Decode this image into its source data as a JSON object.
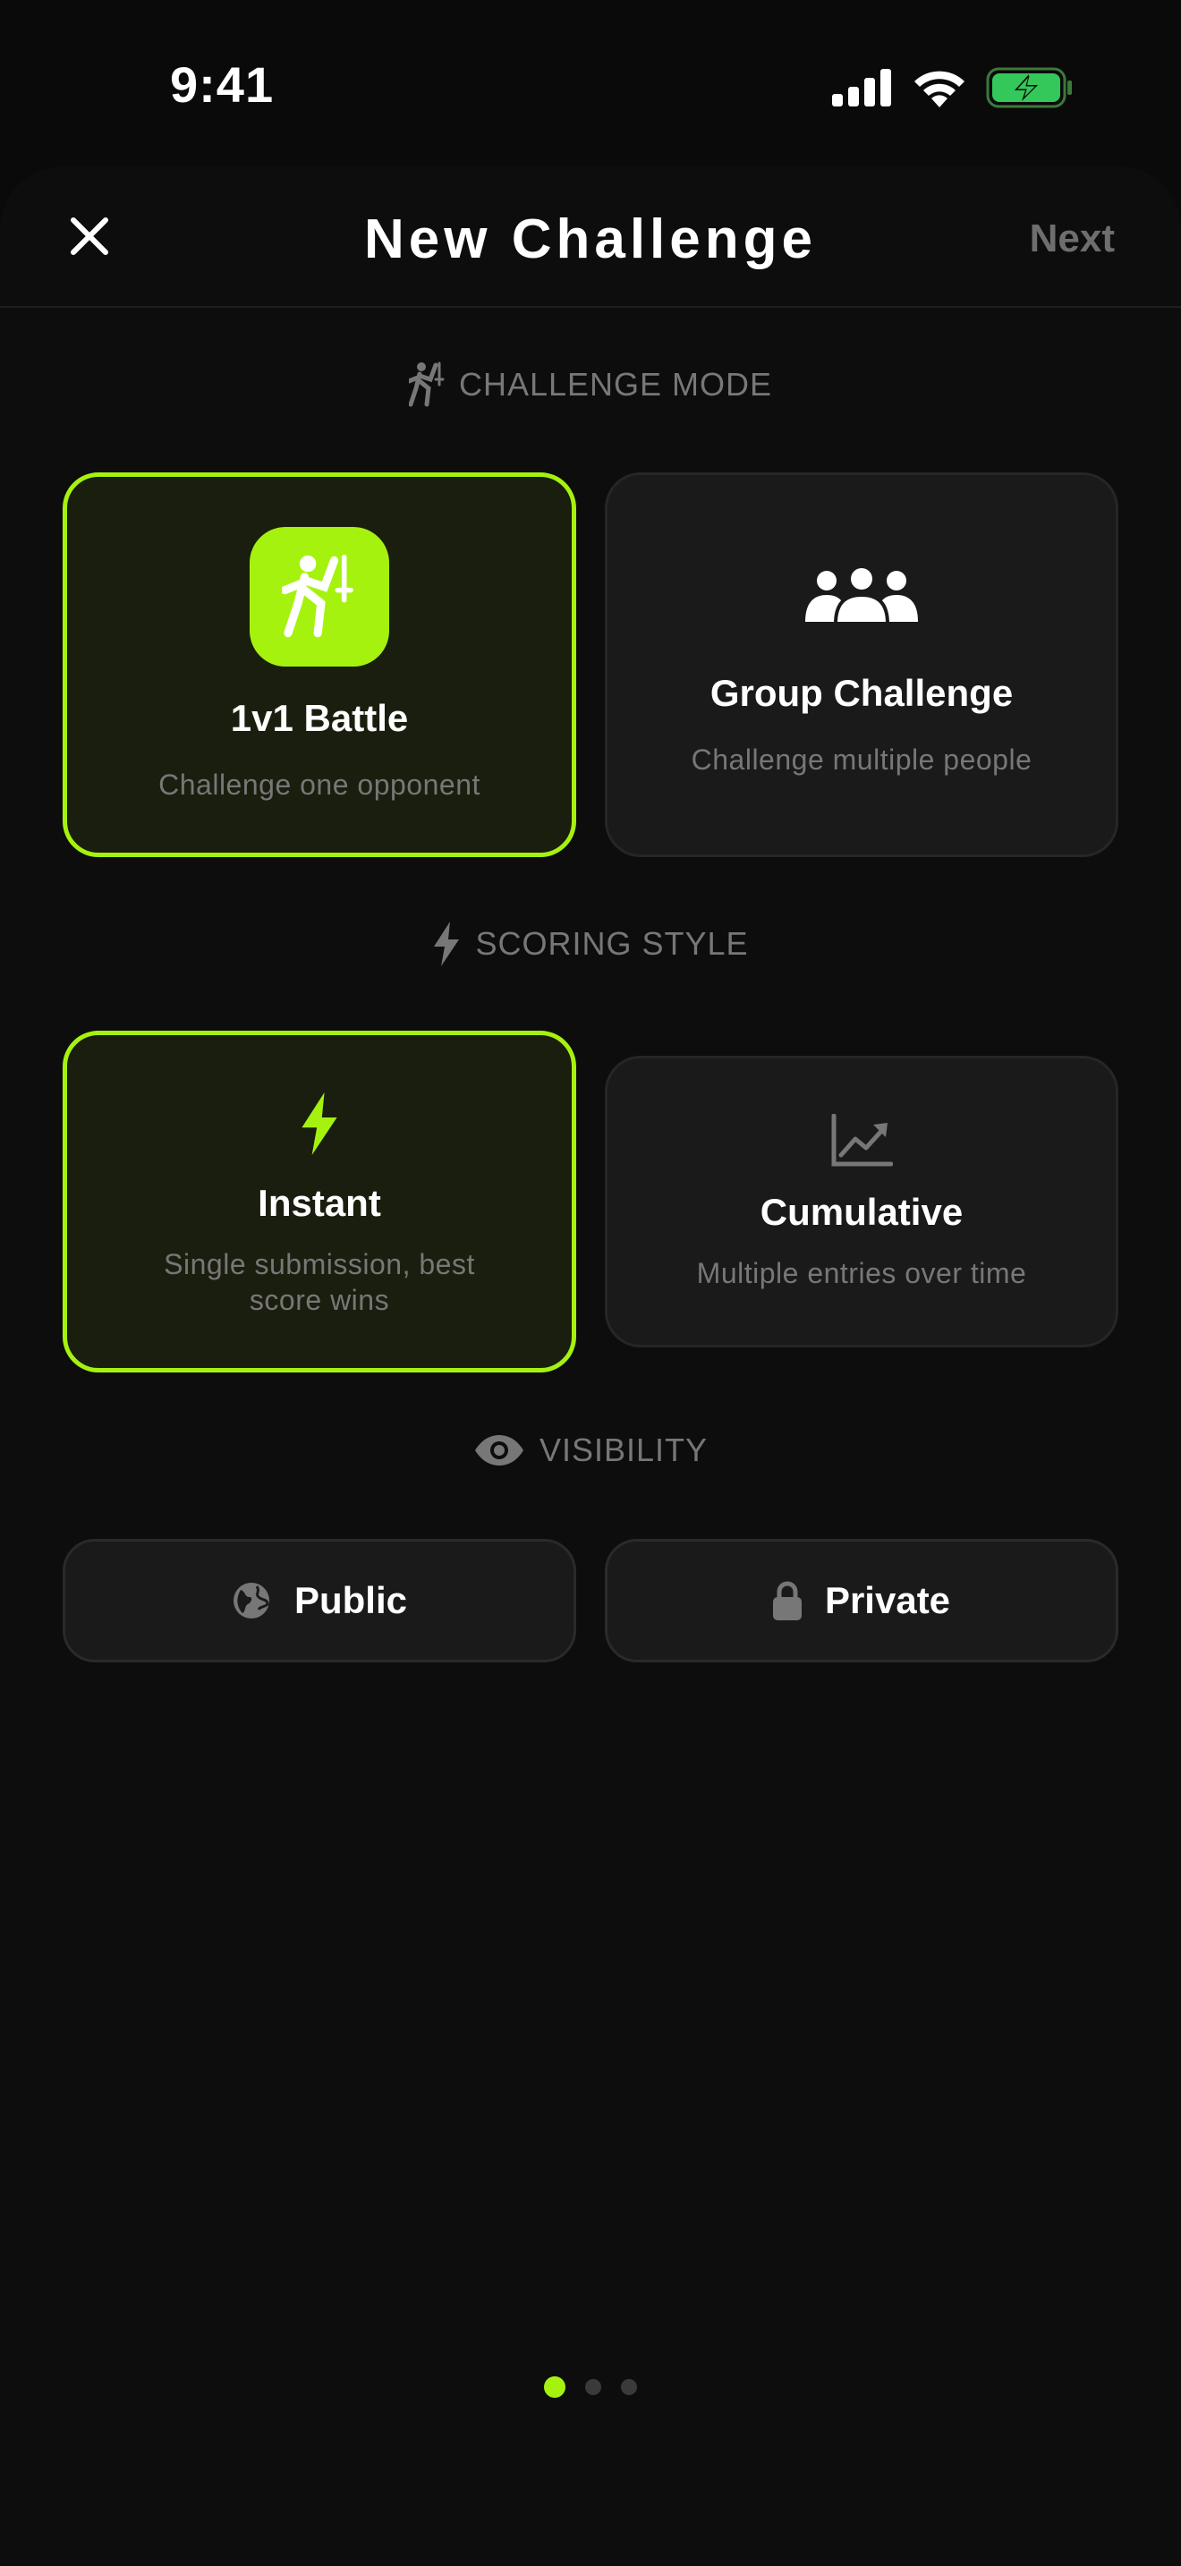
{
  "status_bar": {
    "time": "9:41"
  },
  "header": {
    "title": "New Challenge",
    "next_label": "Next",
    "close_icon": "close-icon"
  },
  "challenge_mode": {
    "heading": "CHALLENGE MODE",
    "options": [
      {
        "title": "1v1 Battle",
        "subtitle": "Challenge one opponent",
        "icon": "fencing-icon",
        "selected": true
      },
      {
        "title": "Group Challenge",
        "subtitle": "Challenge multiple people",
        "icon": "group-icon",
        "selected": false
      }
    ]
  },
  "scoring_style": {
    "heading": "SCORING STYLE",
    "options": [
      {
        "title": "Instant",
        "subtitle_line1": "Single submission, best",
        "subtitle_line2": "score wins",
        "icon": "bolt-icon",
        "selected": true
      },
      {
        "title": "Cumulative",
        "subtitle": "Multiple entries over time",
        "icon": "chart-icon",
        "selected": false
      }
    ]
  },
  "visibility": {
    "heading": "VISIBILITY",
    "options": [
      {
        "label": "Public",
        "icon": "globe-icon"
      },
      {
        "label": "Private",
        "icon": "lock-icon"
      }
    ]
  },
  "pagination": {
    "total": 3,
    "current": 1
  },
  "colors": {
    "accent": "#a6f20f",
    "background": "#0a0a0a",
    "card": "#1a1a1a",
    "selected_card": "#1a1e0e",
    "muted_text": "#777777",
    "battery_fill": "#34c759"
  }
}
